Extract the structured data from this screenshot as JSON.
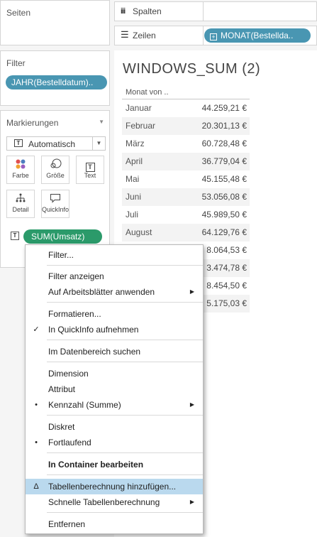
{
  "pages_card": {
    "title": "Seiten"
  },
  "filter_card": {
    "title": "Filter",
    "pill": "JAHR(Bestelldatum).."
  },
  "marks_card": {
    "title": "Markierungen",
    "dropdown_value": "Automatisch",
    "buttons": [
      {
        "label": "Farbe",
        "icon": "color-dots-icon"
      },
      {
        "label": "Größe",
        "icon": "size-icon"
      },
      {
        "label": "Text",
        "icon": "text-icon"
      },
      {
        "label": "Detail",
        "icon": "detail-icon"
      },
      {
        "label": "QuickInfo",
        "icon": "tooltip-icon"
      }
    ],
    "field_pill": "SUM(Umsatz)"
  },
  "columns_shelf": {
    "label": "Spalten"
  },
  "rows_shelf": {
    "label": "Zeilen",
    "pill": "MONAT(Bestellda.."
  },
  "viz": {
    "title": "WINDOWS_SUM (2)",
    "column_header": "Monat von ..",
    "rows": [
      {
        "month": "Januar",
        "value": "44.259,21 €"
      },
      {
        "month": "Februar",
        "value": "20.301,13 €"
      },
      {
        "month": "März",
        "value": "60.728,48 €"
      },
      {
        "month": "April",
        "value": "36.779,04 €"
      },
      {
        "month": "Mai",
        "value": "45.155,48 €"
      },
      {
        "month": "Juni",
        "value": "53.056,08 €"
      },
      {
        "month": "Juli",
        "value": "45.989,50 €"
      },
      {
        "month": "August",
        "value": "64.129,76 €"
      },
      {
        "month": "",
        "value": "8.064,53 €"
      },
      {
        "month": "",
        "value": "3.474,78 €"
      },
      {
        "month": "",
        "value": "8.454,50 €"
      },
      {
        "month": "",
        "value": "5.175,03 €"
      }
    ]
  },
  "context_menu": {
    "items": [
      {
        "label": "Filter..."
      },
      {
        "label": "Filter anzeigen"
      },
      {
        "label": "Auf Arbeitsblätter anwenden",
        "submenu": true
      },
      {
        "label": "Formatieren..."
      },
      {
        "label": "In QuickInfo aufnehmen",
        "mark": "✓"
      },
      {
        "label": "Im Datenbereich suchen"
      },
      {
        "label": "Dimension"
      },
      {
        "label": "Attribut"
      },
      {
        "label": "Kennzahl (Summe)",
        "mark": "•",
        "submenu": true
      },
      {
        "label": "Diskret"
      },
      {
        "label": "Fortlaufend",
        "mark": "•"
      },
      {
        "label": "In Container bearbeiten"
      },
      {
        "label": "Tabellenberechnung hinzufügen...",
        "mark": "Δ"
      },
      {
        "label": "Schnelle Tabellenberechnung",
        "submenu": true
      },
      {
        "label": "Entfernen"
      }
    ]
  }
}
